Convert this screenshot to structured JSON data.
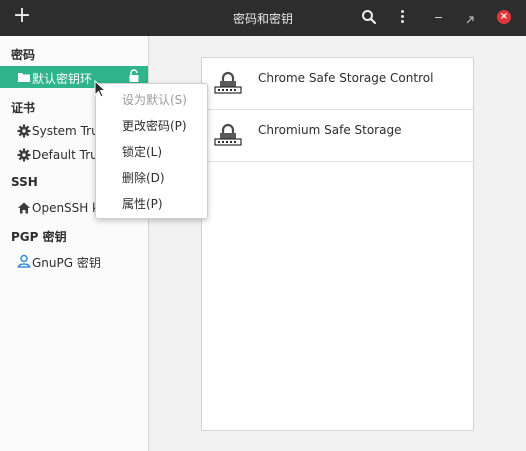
{
  "header": {
    "add_glyph": "+",
    "title": "密码和密钥",
    "close_glyph": "×",
    "icons": [
      "add-icon",
      "search-icon",
      "menu-icon",
      "minimize-icon",
      "restore-icon",
      "close-icon"
    ]
  },
  "sidebar": {
    "sections": [
      {
        "title": "密码"
      },
      {
        "title": "证书"
      },
      {
        "title": "SSH"
      },
      {
        "title": "PGP 密钥"
      }
    ],
    "items": [
      {
        "label": "默认密钥环",
        "icon": "folder-icon",
        "selected": true
      },
      {
        "label": "System Trust",
        "icon": "gear-icon"
      },
      {
        "label": "Default Trust",
        "icon": "gear-icon"
      },
      {
        "label": "OpenSSH keys",
        "icon": "home-icon"
      },
      {
        "label": "GnuPG 密钥",
        "icon": "person-icon"
      }
    ]
  },
  "content": {
    "rows": [
      {
        "name": "Chrome Safe Storage Control",
        "icon": "lock-icon"
      },
      {
        "name": "Chromium Safe Storage",
        "icon": "lock-icon"
      }
    ]
  },
  "context_menu": {
    "items": [
      {
        "label": "设为默认(S)",
        "disabled": true
      },
      {
        "label": "更改密码(P)"
      },
      {
        "label": "锁定(L)"
      },
      {
        "label": "删除(D)"
      },
      {
        "label": "属性(P)"
      }
    ]
  },
  "colors": {
    "header_bg": "#2d2d2d",
    "accent": "#30b48a",
    "close_red": "#e0383a"
  }
}
